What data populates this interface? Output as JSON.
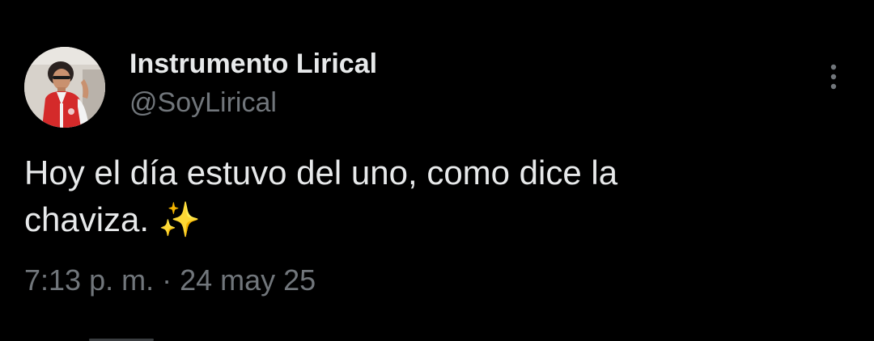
{
  "tweet": {
    "author": {
      "display_name": "Instrumento Lirical",
      "handle": "@SoyLirical",
      "avatar_icon": "profile-photo"
    },
    "more_icon": "more-vertical-icon",
    "text_line1": "Hoy el día estuvo del uno, como dice la",
    "text_line2": "chaviza. ",
    "emoji": "✨",
    "time": "7:13 p. m.",
    "separator": " · ",
    "date": "24 may 25"
  },
  "colors": {
    "background": "#000000",
    "primary_text": "#e7e9ea",
    "secondary_text": "#71767b",
    "sparkle": "#f5c33b"
  }
}
